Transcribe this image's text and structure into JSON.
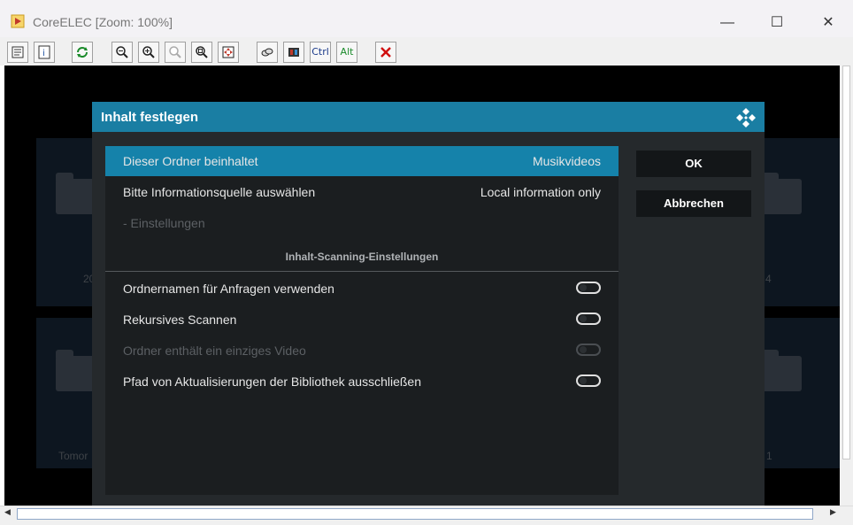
{
  "window": {
    "title": "CoreELEC [Zoom: 100%]",
    "controls": {
      "minimize": "—",
      "maximize": "☐",
      "close": "✕"
    }
  },
  "toolbar": {
    "buttons": [
      {
        "name": "options-icon"
      },
      {
        "name": "info-icon"
      },
      {
        "name": "refresh-icon"
      },
      {
        "name": "zoom-out-icon"
      },
      {
        "name": "zoom-in-icon"
      },
      {
        "name": "zoom-100-icon"
      },
      {
        "name": "zoom-fit-icon"
      },
      {
        "name": "fullscreen-icon"
      },
      {
        "name": "send-keys-icon"
      },
      {
        "name": "record-icon"
      },
      {
        "label": "Ctrl"
      },
      {
        "label": "Alt"
      },
      {
        "name": "disconnect-icon"
      }
    ]
  },
  "background": {
    "labels": [
      "20",
      "4",
      "Tomor",
      "1"
    ]
  },
  "dialog": {
    "title": "Inhalt festlegen",
    "rows": [
      {
        "label": "Dieser Ordner beinhaltet",
        "value": "Musikvideos",
        "selected": true
      },
      {
        "label": "Bitte Informationsquelle auswählen",
        "value": "Local information only"
      },
      {
        "label": "- Einstellungen",
        "disabled": true
      }
    ],
    "section_title": "Inhalt-Scanning-Einstellungen",
    "toggles": [
      {
        "label": "Ordnernamen für Anfragen verwenden",
        "on": false
      },
      {
        "label": "Rekursives Scannen",
        "on": false
      },
      {
        "label": "Ordner enthält ein einziges Video",
        "on": false,
        "disabled": true
      },
      {
        "label": "Pfad von Aktualisierungen der Bibliothek ausschließen",
        "on": false
      }
    ],
    "ok_label": "OK",
    "cancel_label": "Abbrechen"
  },
  "colors": {
    "accent": "#1582aa",
    "header": "#1a7ea3",
    "dialog_bg": "#25292c",
    "panel_bg": "#1b1e20"
  }
}
